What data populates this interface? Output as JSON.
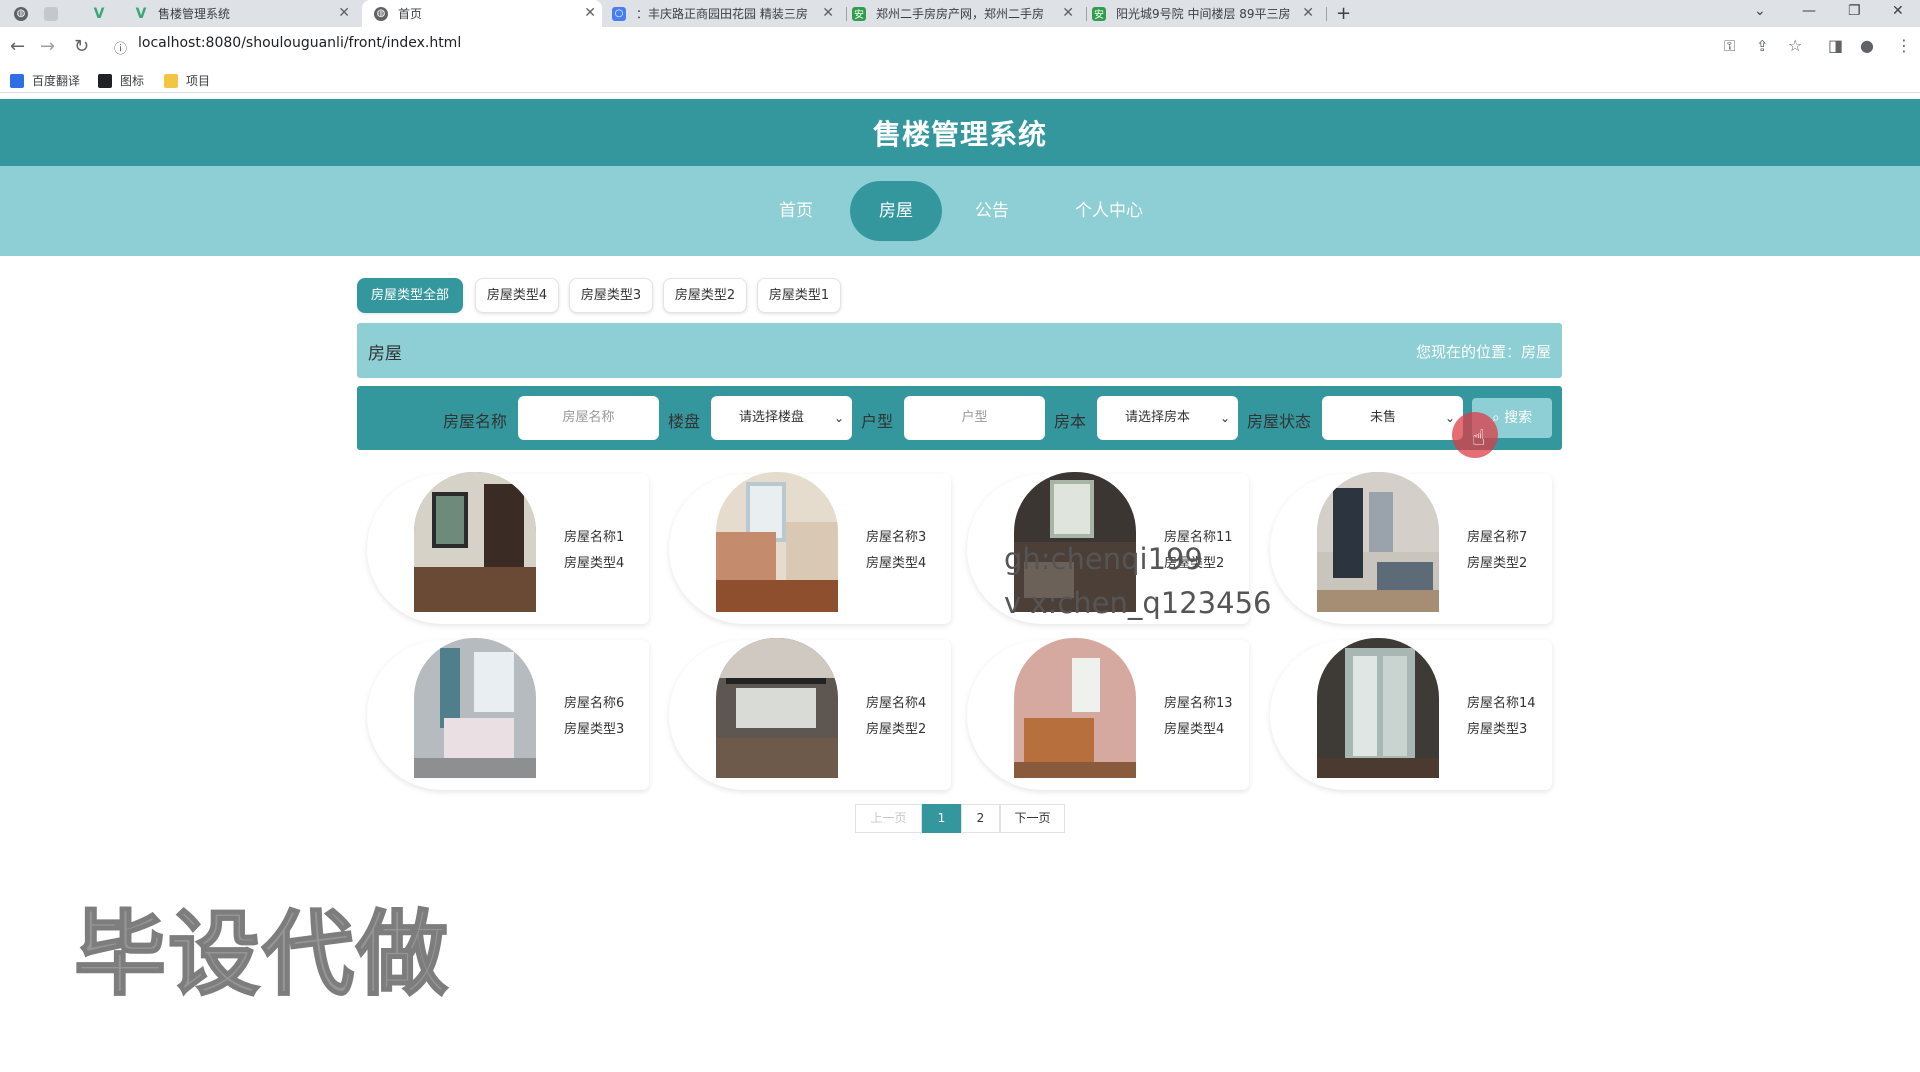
{
  "browser": {
    "tabs": [
      {
        "title": "",
        "icon": "globe-icon"
      },
      {
        "title": "",
        "icon": "blank-tab-icon"
      },
      {
        "title": "",
        "icon": "vue-icon"
      },
      {
        "title": "售楼管理系统",
        "icon": "vue-icon"
      },
      {
        "title": "首页",
        "icon": "globe-icon",
        "active": true
      },
      {
        "title": "：丰庆路正商园田花园 精装三房",
        "icon": "page-icon"
      },
      {
        "title": "郑州二手房房产网，郑州二手房",
        "icon": "anjuke-icon"
      },
      {
        "title": "阳光城9号院 中间楼层 89平三房",
        "icon": "anjuke-icon"
      }
    ],
    "new_tab": "+",
    "url": "localhost:8080/shoulouguanli/front/index.html",
    "bookmarks": [
      {
        "label": "百度翻译",
        "icon": "baidu-translate-icon"
      },
      {
        "label": "图标",
        "icon": "image-icon"
      },
      {
        "label": "项目",
        "icon": "folder-icon"
      }
    ]
  },
  "site": {
    "title": "售楼管理系统",
    "nav": [
      "首页",
      "房屋",
      "公告",
      "个人中心"
    ],
    "nav_active": "房屋"
  },
  "categories": [
    "房屋类型全部",
    "房屋类型4",
    "房屋类型3",
    "房屋类型2",
    "房屋类型1"
  ],
  "section": {
    "title": "房屋",
    "location_label": "您现在的位置：房屋"
  },
  "search": {
    "name_label": "房屋名称",
    "name_placeholder": "房屋名称",
    "building_label": "楼盘",
    "building_value": "请选择楼盘",
    "layout_label": "户型",
    "layout_placeholder": "户型",
    "copy_label": "房本",
    "copy_value": "请选择房本",
    "status_label": "房屋状态",
    "status_value": "未售",
    "button_label": "搜索"
  },
  "houses": [
    {
      "name": "房屋名称1",
      "type": "房屋类型4"
    },
    {
      "name": "房屋名称3",
      "type": "房屋类型4"
    },
    {
      "name": "房屋名称11",
      "type": "房屋类型2"
    },
    {
      "name": "房屋名称7",
      "type": "房屋类型2"
    },
    {
      "name": "房屋名称6",
      "type": "房屋类型3"
    },
    {
      "name": "房屋名称4",
      "type": "房屋类型2"
    },
    {
      "name": "房屋名称13",
      "type": "房屋类型4"
    },
    {
      "name": "房屋名称14",
      "type": "房屋类型3"
    }
  ],
  "pagination": {
    "prev": "上一页",
    "pages": [
      "1",
      "2"
    ],
    "current": "1",
    "next": "下一页"
  },
  "overlay": {
    "line1": "gh:chenqi199",
    "line2": "v x:chen_q123456",
    "big": "毕设代做"
  },
  "colors": {
    "primary": "#35979e",
    "secondary": "#8dcfd4"
  }
}
